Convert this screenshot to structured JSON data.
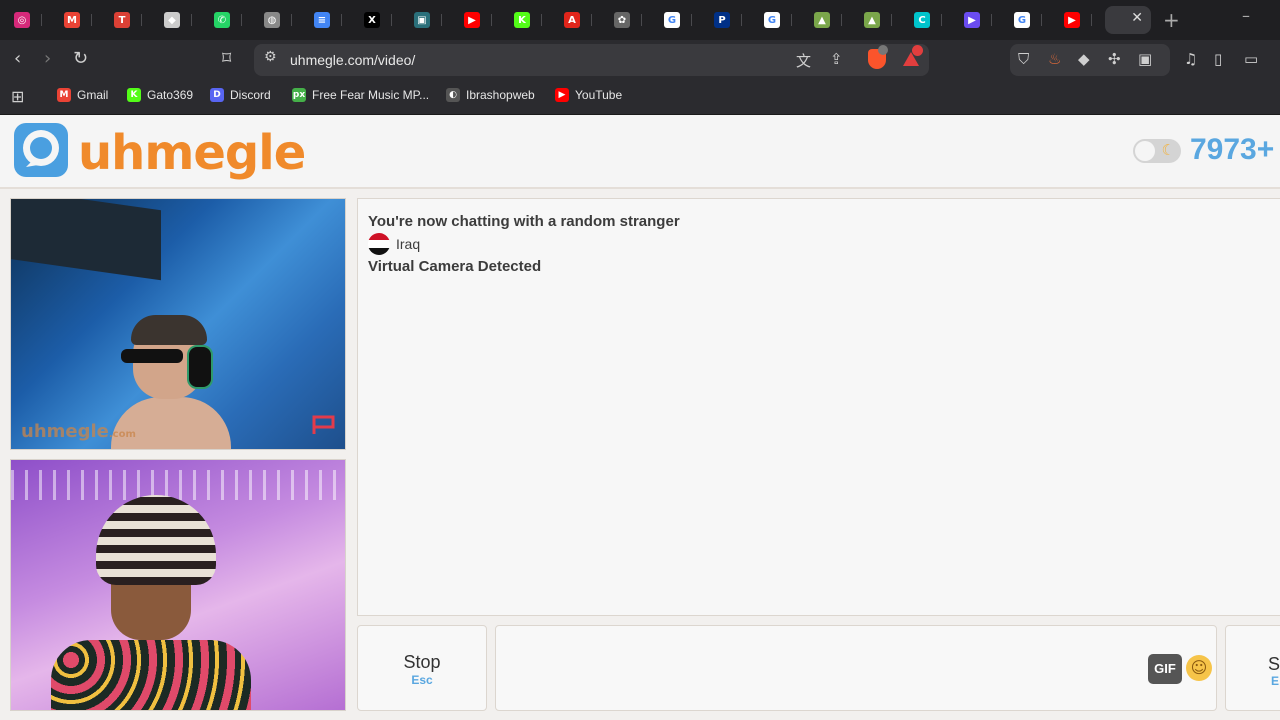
{
  "browser": {
    "tabs": [
      {
        "icon": "instagram-icon",
        "color": "#d6297a",
        "glyph": "◎"
      },
      {
        "icon": "gmail-icon",
        "color": "#ea4335",
        "glyph": "M"
      },
      {
        "icon": "todoist-icon",
        "color": "#db4035",
        "glyph": "T"
      },
      {
        "icon": "diamond-icon",
        "color": "#cccccc",
        "glyph": "◆"
      },
      {
        "icon": "whatsapp-icon",
        "color": "#25d366",
        "glyph": "✆"
      },
      {
        "icon": "globe-icon",
        "color": "#888888",
        "glyph": "◍"
      },
      {
        "icon": "docs-icon",
        "color": "#4285f4",
        "glyph": "≡"
      },
      {
        "icon": "x-icon",
        "color": "#000000",
        "glyph": "X"
      },
      {
        "icon": "site-icon",
        "color": "#2a6f7a",
        "glyph": "▣"
      },
      {
        "icon": "youtube-icon",
        "color": "#ff0000",
        "glyph": "▶"
      },
      {
        "icon": "kick-icon",
        "color": "#53fc18",
        "glyph": "K"
      },
      {
        "icon": "adobe-icon",
        "color": "#e1251b",
        "glyph": "A"
      },
      {
        "icon": "openai-icon",
        "color": "#666666",
        "glyph": "✿"
      },
      {
        "icon": "google-icon",
        "color": "#ffffff",
        "glyph": "G"
      },
      {
        "icon": "paypal-icon",
        "color": "#003087",
        "glyph": "P"
      },
      {
        "icon": "google-icon",
        "color": "#ffffff",
        "glyph": "G"
      },
      {
        "icon": "extension-icon",
        "color": "#7aa64a",
        "glyph": "▲"
      },
      {
        "icon": "extension-icon",
        "color": "#7aa64a",
        "glyph": "▲"
      },
      {
        "icon": "canva-icon",
        "color": "#00c4cc",
        "glyph": "C"
      },
      {
        "icon": "video-icon",
        "color": "#6a4cf0",
        "glyph": "▶"
      },
      {
        "icon": "google-icon",
        "color": "#ffffff",
        "glyph": "G"
      },
      {
        "icon": "youtube-icon",
        "color": "#ff0000",
        "glyph": "▶"
      }
    ],
    "url": "uhmegle.com/video/",
    "bookmarks": [
      {
        "label": "Gmail",
        "color": "#ea4335",
        "glyph": "M"
      },
      {
        "label": "Gato369",
        "color": "#53fc18",
        "glyph": "K"
      },
      {
        "label": "Discord",
        "color": "#5865f2",
        "glyph": "D"
      },
      {
        "label": "Free Fear Music MP...",
        "color": "#45b049",
        "glyph": "px"
      },
      {
        "label": "Ibrashopweb",
        "color": "#555555",
        "glyph": "◐"
      },
      {
        "label": "YouTube",
        "color": "#ff0000",
        "glyph": "▶"
      }
    ]
  },
  "site": {
    "logo": "uhmegle",
    "online_count": "7973+",
    "watermark": "uhmegle",
    "watermark_suffix": ".com"
  },
  "chat": {
    "line1": "You're now chatting with a random stranger",
    "country": "Iraq",
    "line3": "Virtual Camera Detected"
  },
  "controls": {
    "stop_label": "Stop",
    "stop_key": "Esc",
    "gif_label": "GIF",
    "send_label": "S",
    "send_key": "E"
  }
}
